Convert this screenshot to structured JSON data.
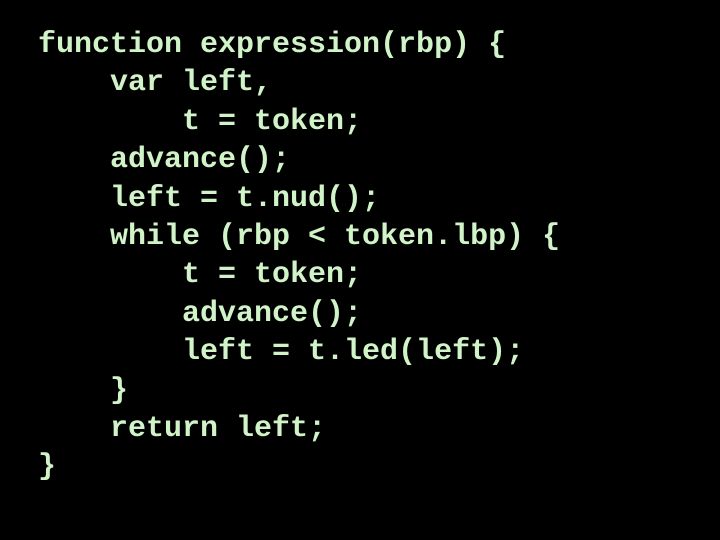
{
  "code": {
    "lines": [
      "function expression(rbp) {",
      "    var left,",
      "        t = token;",
      "    advance();",
      "    left = t.nud();",
      "    while (rbp < token.lbp) {",
      "        t = token;",
      "        advance();",
      "        left = t.led(left);",
      "    }",
      "    return left;",
      "}"
    ]
  }
}
